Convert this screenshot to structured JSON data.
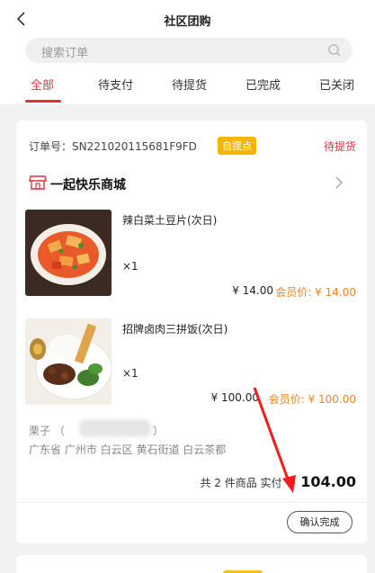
{
  "header": {
    "title": "社区团购"
  },
  "search": {
    "placeholder": "搜索订单"
  },
  "tabs": [
    {
      "label": "全部",
      "active": true
    },
    {
      "label": "待支付"
    },
    {
      "label": "待提货"
    },
    {
      "label": "已完成"
    },
    {
      "label": "已关闭"
    }
  ],
  "order": {
    "order_no_label": "订单号：SN221020115681F9FD",
    "pickup_badge": "自提点",
    "status": "待提货",
    "store_name": "一起快乐商城",
    "items": [
      {
        "name": "辣白菜土豆片(次日)",
        "qty": "×1",
        "price": "¥ 14.00",
        "member_price": "会员价: ¥ 14.00"
      },
      {
        "name": "招牌卤肉三拼饭(次日)",
        "qty": "×1",
        "price": "¥ 100.00",
        "member_price": "会员价: ¥ 100.00"
      }
    ],
    "recipient_name": "栗子 （",
    "recipient_phone_tail": "）",
    "address": "广东省 广州市 白云区 黄石街道 白云茶都",
    "summary_prefix": "共 2 件商品  实付",
    "total_amount": "¥ 104.00",
    "confirm_label": "确认完成"
  },
  "colors": {
    "accent": "#e0303c",
    "badge": "#f7b500",
    "member": "#f58220"
  }
}
